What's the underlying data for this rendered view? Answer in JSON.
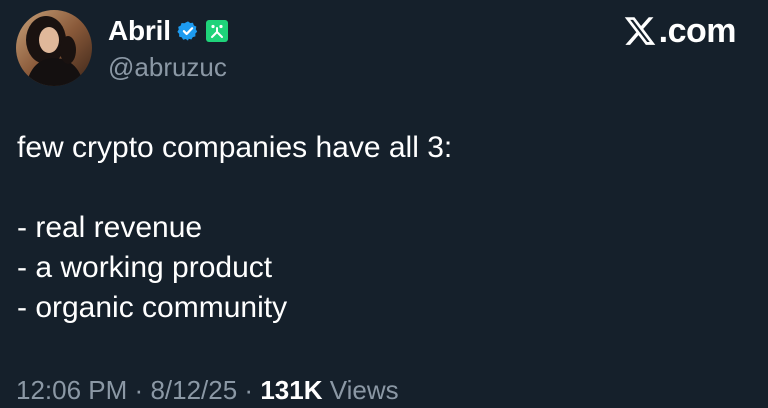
{
  "author": {
    "display_name": "Abril",
    "handle": "@abruzuc",
    "verified_icon": "verified-badge-icon",
    "affiliate_icon": "affiliate-badge-icon",
    "verified_color": "#1d9bf0",
    "affiliate_color": "#1fd37a"
  },
  "brand": {
    "logo_icon": "x-logo-icon",
    "text": ".com"
  },
  "post": {
    "lines": [
      "few crypto companies have all 3:",
      "",
      "- real revenue",
      "- a working product",
      "- organic community"
    ]
  },
  "meta": {
    "time": "12:06 PM",
    "separator": "·",
    "date": "8/12/25",
    "views_count": "131K",
    "views_label": "Views"
  },
  "colors": {
    "background": "#15202b",
    "primary_text": "#ffffff",
    "secondary_text": "#8b98a5"
  }
}
